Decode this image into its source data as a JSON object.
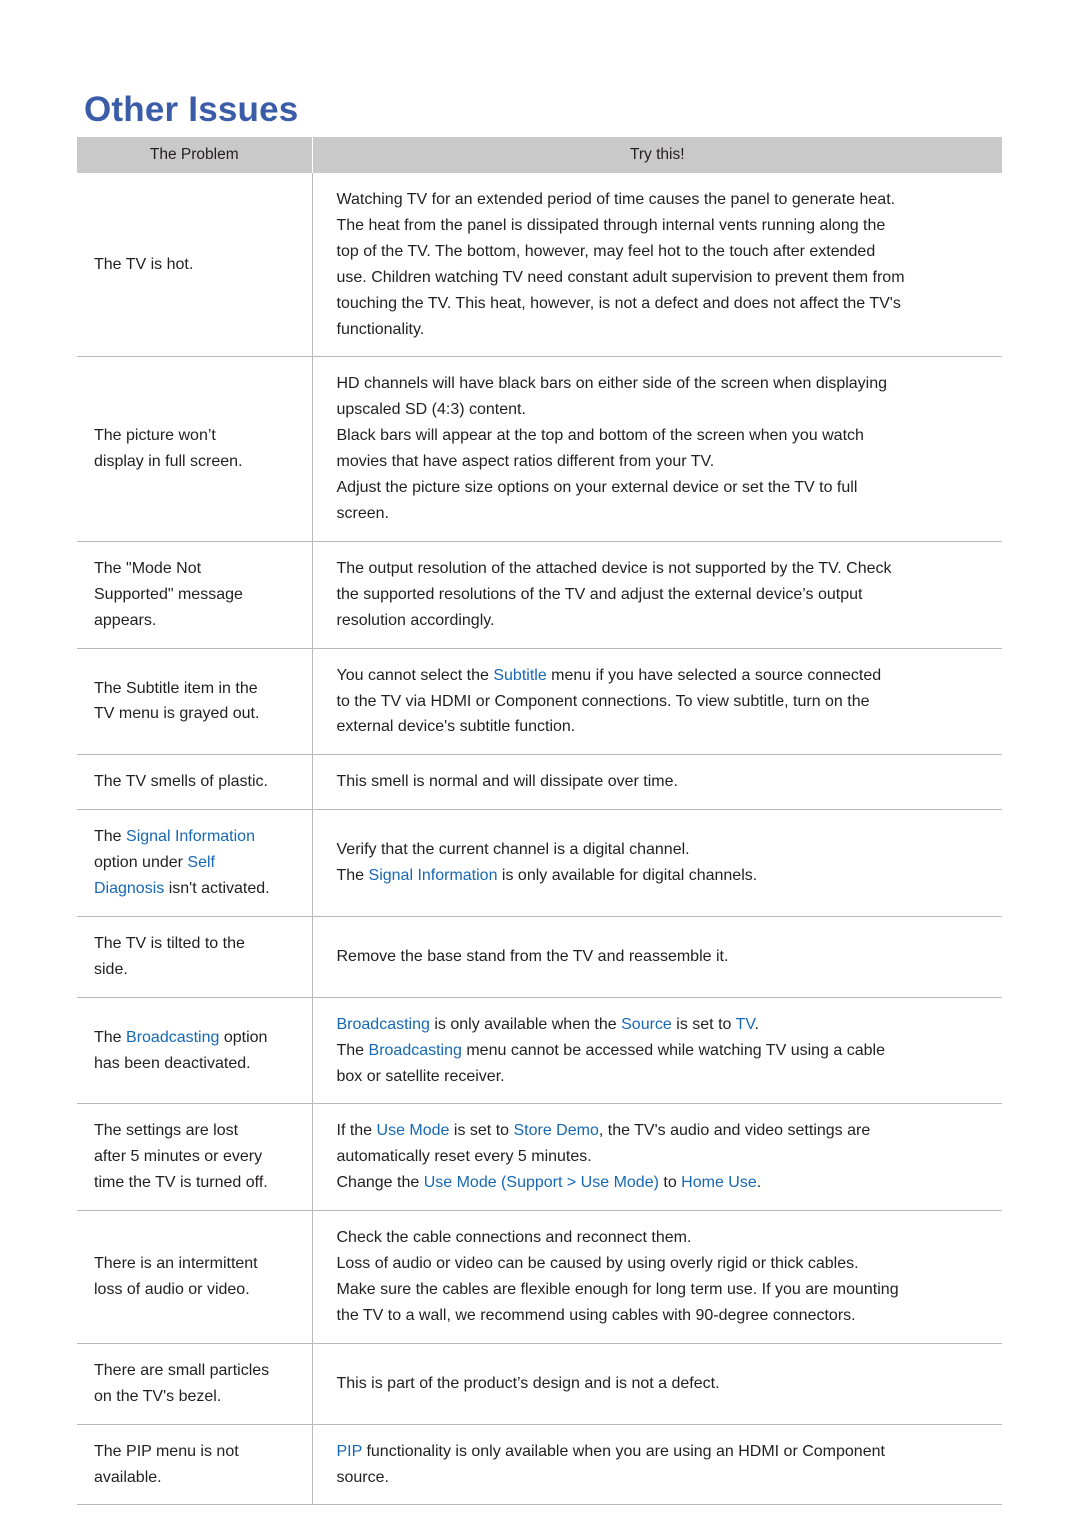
{
  "page": {
    "title": "Other Issues"
  },
  "table": {
    "headers": {
      "problem": "The Problem",
      "try": "Try this!"
    },
    "rows": [
      {
        "problem_lines": [
          "The TV is hot."
        ],
        "try_lines": [
          "Watching TV for an extended period of time causes the panel to generate heat.",
          "The heat from the panel is dissipated through internal vents running along the",
          "top of the TV. The bottom, however, may feel hot to the touch after extended",
          "use. Children watching TV need constant adult supervision to prevent them from",
          "touching the TV. This heat, however, is not a defect and does not affect the TV's",
          "functionality."
        ]
      },
      {
        "problem_lines": [
          "The picture won’t",
          "display in full screen."
        ],
        "try_lines": [
          "HD channels will have black bars on either side of the screen when displaying",
          "upscaled SD (4:3) content.",
          "Black bars will appear at the top and bottom of the screen when you watch",
          "movies that have aspect ratios different from your TV.",
          "Adjust the picture size options on your external device or set the TV to full",
          "screen."
        ]
      },
      {
        "problem_lines": [
          "The \"Mode Not",
          "Supported\" message",
          "appears."
        ],
        "try_lines": [
          "The output resolution of the attached device is not supported by the TV. Check",
          "the supported resolutions of the TV and adjust the external device’s output",
          "resolution accordingly."
        ]
      },
      {
        "problem_lines": [
          "The Subtitle item in the",
          "TV menu is grayed out."
        ],
        "try_rich": [
          [
            {
              "t": "You cannot select the ",
              "hl": false
            },
            {
              "t": "Subtitle",
              "hl": true
            },
            {
              "t": " menu if you have selected a source connected",
              "hl": false
            }
          ],
          [
            {
              "t": "to the TV via HDMI or Component connections. To view subtitle, turn on the",
              "hl": false
            }
          ],
          [
            {
              "t": "external device's subtitle function.",
              "hl": false
            }
          ]
        ]
      },
      {
        "problem_lines": [
          "The TV smells of plastic."
        ],
        "try_lines": [
          "This smell is normal and will dissipate over time."
        ]
      },
      {
        "problem_rich": [
          [
            {
              "t": "The ",
              "hl": false
            },
            {
              "t": "Signal Information",
              "hl": true
            }
          ],
          [
            {
              "t": "option under ",
              "hl": false
            },
            {
              "t": "Self",
              "hl": true
            }
          ],
          [
            {
              "t": "Diagnosis",
              "hl": true
            },
            {
              "t": " isn't activated.",
              "hl": false
            }
          ]
        ],
        "try_rich": [
          [
            {
              "t": "Verify that the current channel is a digital channel.",
              "hl": false
            }
          ],
          [
            {
              "t": "The ",
              "hl": false
            },
            {
              "t": "Signal Information",
              "hl": true
            },
            {
              "t": " is only available for digital channels.",
              "hl": false
            }
          ]
        ]
      },
      {
        "problem_lines": [
          "The TV is tilted to the",
          "side."
        ],
        "try_lines": [
          "Remove the base stand from the TV and reassemble it."
        ]
      },
      {
        "problem_rich": [
          [
            {
              "t": "The ",
              "hl": false
            },
            {
              "t": "Broadcasting",
              "hl": true
            },
            {
              "t": " option",
              "hl": false
            }
          ],
          [
            {
              "t": "has been deactivated.",
              "hl": false
            }
          ]
        ],
        "try_rich": [
          [
            {
              "t": "Broadcasting",
              "hl": true
            },
            {
              "t": " is only available when the ",
              "hl": false
            },
            {
              "t": "Source",
              "hl": true
            },
            {
              "t": " is set to ",
              "hl": false
            },
            {
              "t": "TV",
              "hl": true
            },
            {
              "t": ".",
              "hl": false
            }
          ],
          [
            {
              "t": "The ",
              "hl": false
            },
            {
              "t": "Broadcasting",
              "hl": true
            },
            {
              "t": " menu cannot be accessed while watching TV using a cable",
              "hl": false
            }
          ],
          [
            {
              "t": "box or satellite receiver.",
              "hl": false
            }
          ]
        ]
      },
      {
        "problem_lines": [
          "The settings are lost",
          "after 5 minutes or every",
          "time the TV is turned off."
        ],
        "try_rich": [
          [
            {
              "t": "If the ",
              "hl": false
            },
            {
              "t": "Use Mode",
              "hl": true
            },
            {
              "t": " is set to ",
              "hl": false
            },
            {
              "t": "Store Demo",
              "hl": true
            },
            {
              "t": ", the TV's audio and video settings are",
              "hl": false
            }
          ],
          [
            {
              "t": "automatically reset every 5 minutes.",
              "hl": false
            }
          ],
          [
            {
              "t": "Change the ",
              "hl": false
            },
            {
              "t": "Use Mode",
              "hl": true
            },
            {
              "t": " (",
              "hl": true
            },
            {
              "t": "Support",
              "hl": true
            },
            {
              "t": " > ",
              "hl": true
            },
            {
              "t": "Use Mode",
              "hl": true
            },
            {
              "t": ")",
              "hl": true
            },
            {
              "t": " to ",
              "hl": false
            },
            {
              "t": "Home Use",
              "hl": true
            },
            {
              "t": ".",
              "hl": false
            }
          ]
        ]
      },
      {
        "problem_lines": [
          "There is an intermittent",
          "loss of audio or video."
        ],
        "try_lines": [
          "Check the cable connections and reconnect them.",
          "Loss of audio or video can be caused by using overly rigid or thick cables.",
          "Make sure the cables are flexible enough for long term use. If you are mounting",
          "the TV to a wall, we recommend using cables with 90-degree connectors."
        ]
      },
      {
        "problem_lines": [
          "There are small particles",
          "on the TV's bezel."
        ],
        "try_lines": [
          "This is part of the product’s design and is not a defect."
        ]
      },
      {
        "problem_lines": [
          "The PIP menu is not",
          "available."
        ],
        "try_rich": [
          [
            {
              "t": "PIP",
              "hl": true
            },
            {
              "t": " functionality is only available when you are using an HDMI or Component",
              "hl": false
            }
          ],
          [
            {
              "t": "source.",
              "hl": false
            }
          ]
        ]
      }
    ]
  },
  "colors": {
    "title_blue": "#3b5ca8",
    "highlight_blue": "#1668b3",
    "header_gray": "#c9c9c9",
    "border_gray": "#b9b9b9",
    "text": "#231f20"
  }
}
